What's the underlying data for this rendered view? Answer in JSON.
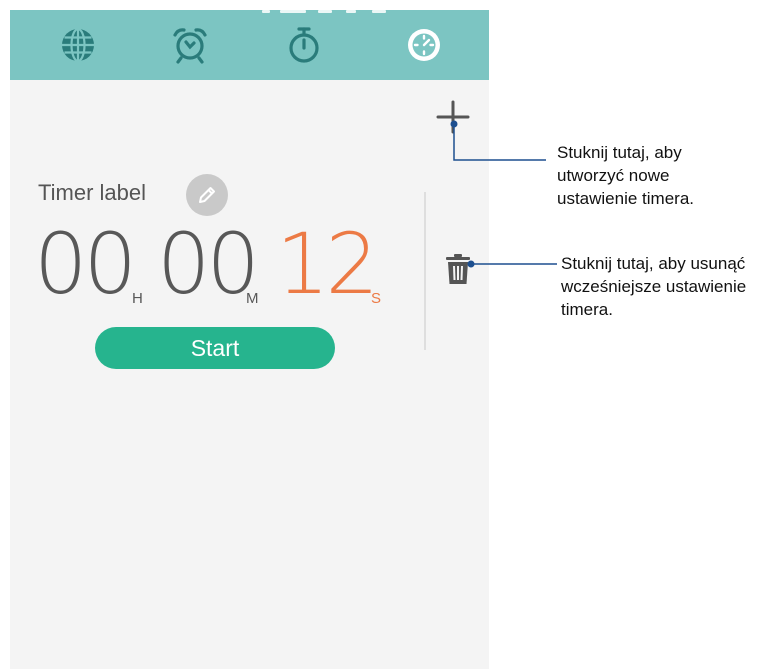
{
  "tabs": [
    {
      "name": "world-clock",
      "icon": "globe-icon",
      "active": false
    },
    {
      "name": "alarm",
      "icon": "alarm-clock-icon",
      "active": false
    },
    {
      "name": "stopwatch",
      "icon": "stopwatch-icon",
      "active": false
    },
    {
      "name": "timer",
      "icon": "timer-icon",
      "active": true
    }
  ],
  "timer": {
    "label": "Timer label",
    "hours": "00",
    "hours_unit": "H",
    "minutes": "00",
    "minutes_unit": "M",
    "seconds": "12",
    "seconds_unit": "S",
    "start_label": "Start"
  },
  "callouts": {
    "add_line1": "Stuknij tutaj, aby",
    "add_line2": "utworzyć nowe",
    "add_line3": "ustawienie timera.",
    "delete_line1": "Stuknij tutaj, aby usunąć",
    "delete_line2": "wcześniejsze ustawienie",
    "delete_line3": "timera."
  },
  "colors": {
    "tab_bar": "#7cc5c2",
    "tab_icon": "#2a7c7b",
    "seconds_accent": "#ec7a45",
    "start_button": "#26b48e",
    "callout_line": "#1d4f8f"
  }
}
